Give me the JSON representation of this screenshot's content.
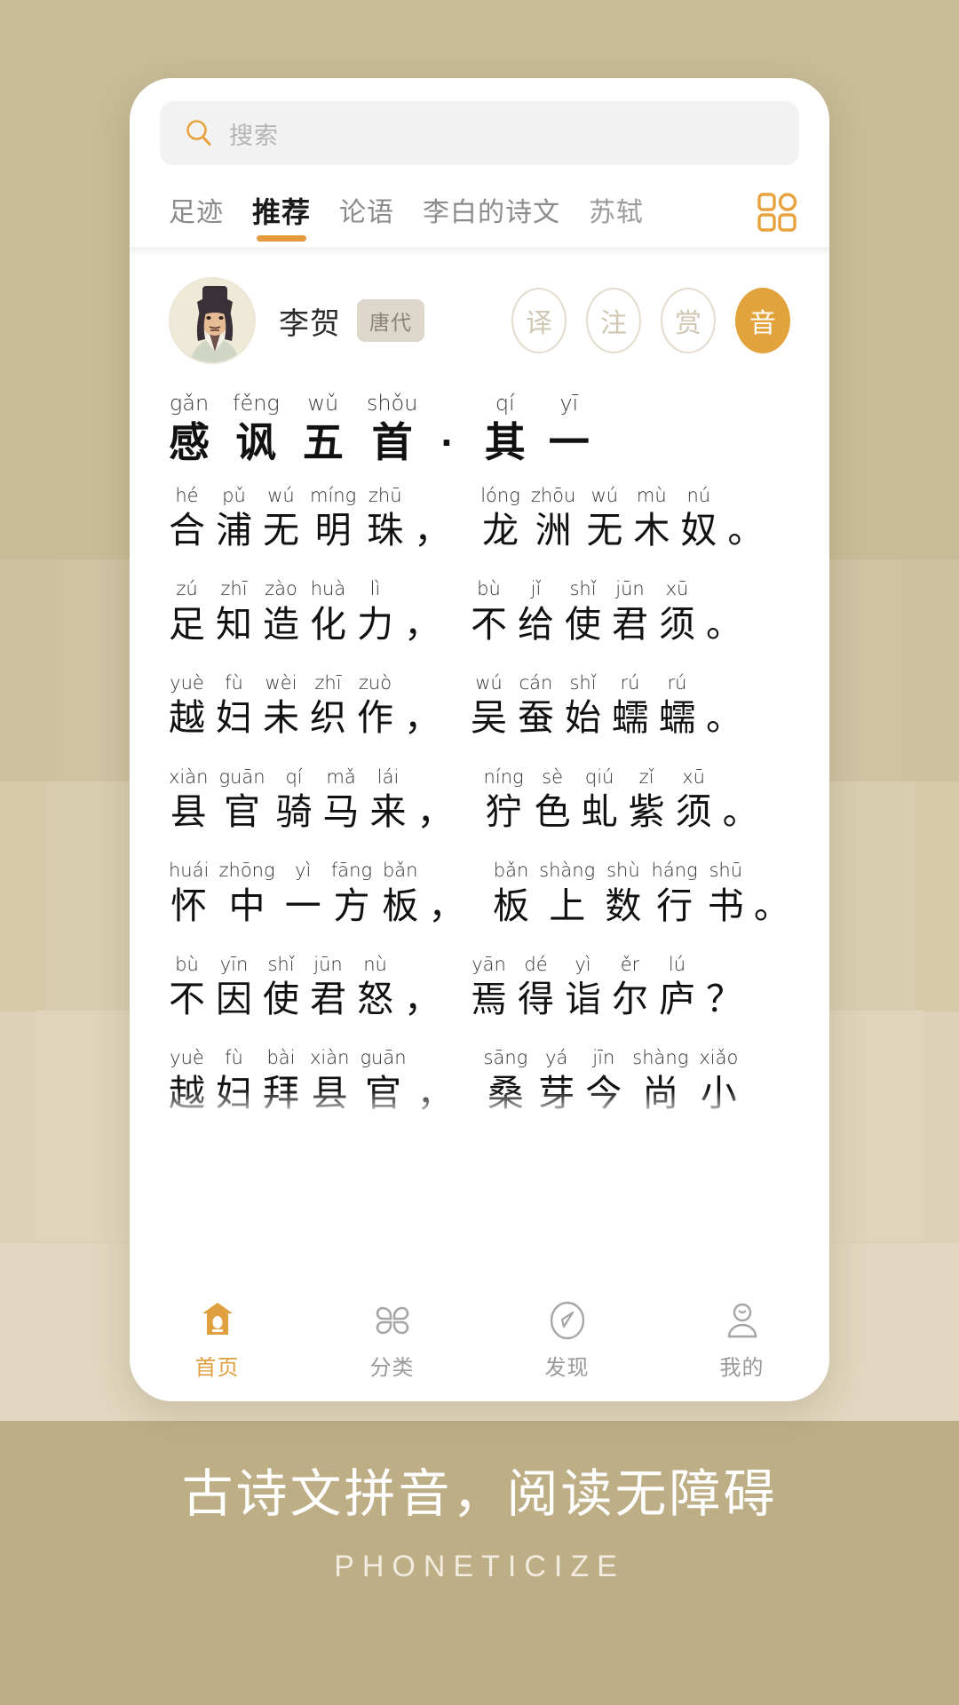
{
  "colors": {
    "accent": "#e3a33c",
    "bg_base": "#c6b893",
    "band_1": "#c9bb97",
    "band_2": "#cdc0a0",
    "band_3": "#d6caab",
    "band_4": "#ddd3b8",
    "band_5": "#bdae86",
    "badge_bg": "#ddd6cb",
    "card_bg": "#ffffff",
    "search_bg": "#f2f2f2"
  },
  "search": {
    "placeholder": "搜索",
    "icon": "search-icon"
  },
  "tabs": {
    "items": [
      {
        "label": "足迹",
        "active": false
      },
      {
        "label": "推荐",
        "active": true
      },
      {
        "label": "论语",
        "active": false
      },
      {
        "label": "李白的诗文",
        "active": false
      },
      {
        "label": "苏轼",
        "active": false
      }
    ],
    "grid_icon": "grid-icon"
  },
  "poet": {
    "avatar": "poet-portrait-avatar",
    "name": "李贺",
    "dynasty": "唐代",
    "actions": [
      {
        "label": "译",
        "active": false,
        "name": "translate-button"
      },
      {
        "label": "注",
        "active": false,
        "name": "annotation-button"
      },
      {
        "label": "赏",
        "active": false,
        "name": "appreciation-button"
      },
      {
        "label": "音",
        "active": true,
        "name": "pinyin-button"
      }
    ]
  },
  "poem": {
    "title": {
      "chars": [
        "感",
        "讽",
        "五",
        "首",
        "·",
        "其",
        "一"
      ],
      "pinyin": [
        "gǎn",
        "fěng",
        "wǔ",
        "shǒu",
        "",
        "qí",
        "yī"
      ]
    },
    "lines": [
      {
        "chars": [
          "合",
          "浦",
          "无",
          "明",
          "珠",
          "，",
          "龙",
          "洲",
          "无",
          "木",
          "奴",
          "。"
        ],
        "pinyin": [
          "hé",
          "pǔ",
          "wú",
          "míng",
          "zhū",
          "",
          "lóng",
          "zhōu",
          "wú",
          "mù",
          "nú",
          ""
        ]
      },
      {
        "chars": [
          "足",
          "知",
          "造",
          "化",
          "力",
          "，",
          "不",
          "给",
          "使",
          "君",
          "须",
          "。"
        ],
        "pinyin": [
          "zú",
          "zhī",
          "zào",
          "huà",
          "lì",
          "",
          "bù",
          "jǐ",
          "shǐ",
          "jūn",
          "xū",
          ""
        ]
      },
      {
        "chars": [
          "越",
          "妇",
          "未",
          "织",
          "作",
          "，",
          "吴",
          "蚕",
          "始",
          "蠕",
          "蠕",
          "。"
        ],
        "pinyin": [
          "yuè",
          "fù",
          "wèi",
          "zhī",
          "zuò",
          "",
          "wú",
          "cán",
          "shǐ",
          "rú",
          "rú",
          ""
        ]
      },
      {
        "chars": [
          "县",
          "官",
          "骑",
          "马",
          "来",
          "，",
          "狞",
          "色",
          "虬",
          "紫",
          "须",
          "。"
        ],
        "pinyin": [
          "xiàn",
          "guān",
          "qí",
          "mǎ",
          "lái",
          "",
          "níng",
          "sè",
          "qiú",
          "zǐ",
          "xū",
          ""
        ]
      },
      {
        "chars": [
          "怀",
          "中",
          "一",
          "方",
          "板",
          "，",
          "板",
          "上",
          "数",
          "行",
          "书",
          "。"
        ],
        "pinyin": [
          "huái",
          "zhōng",
          "yì",
          "fāng",
          "bǎn",
          "",
          "bǎn",
          "shàng",
          "shù",
          "háng",
          "shū",
          ""
        ]
      },
      {
        "chars": [
          "不",
          "因",
          "使",
          "君",
          "怒",
          "，",
          "焉",
          "得",
          "诣",
          "尔",
          "庐",
          "？"
        ],
        "pinyin": [
          "bù",
          "yīn",
          "shǐ",
          "jūn",
          "nù",
          "",
          "yān",
          "dé",
          "yì",
          "ěr",
          "lú",
          ""
        ]
      },
      {
        "chars": [
          "越",
          "妇",
          "拜",
          "县",
          "官",
          "，",
          "桑",
          "芽",
          "今",
          "尚",
          "小"
        ],
        "pinyin": [
          "yuè",
          "fù",
          "bài",
          "xiàn",
          "guān",
          "",
          "sāng",
          "yá",
          "jīn",
          "shàng",
          "xiǎo"
        ]
      }
    ]
  },
  "bottom_nav": {
    "items": [
      {
        "label": "首页",
        "icon": "pagoda-icon",
        "active": true
      },
      {
        "label": "分类",
        "icon": "grid-petals-icon",
        "active": false
      },
      {
        "label": "发现",
        "icon": "compass-icon",
        "active": false
      },
      {
        "label": "我的",
        "icon": "person-icon",
        "active": false
      }
    ]
  },
  "caption": {
    "main": "古诗文拼音，阅读无障碍",
    "sub": "PHONETICIZE"
  }
}
